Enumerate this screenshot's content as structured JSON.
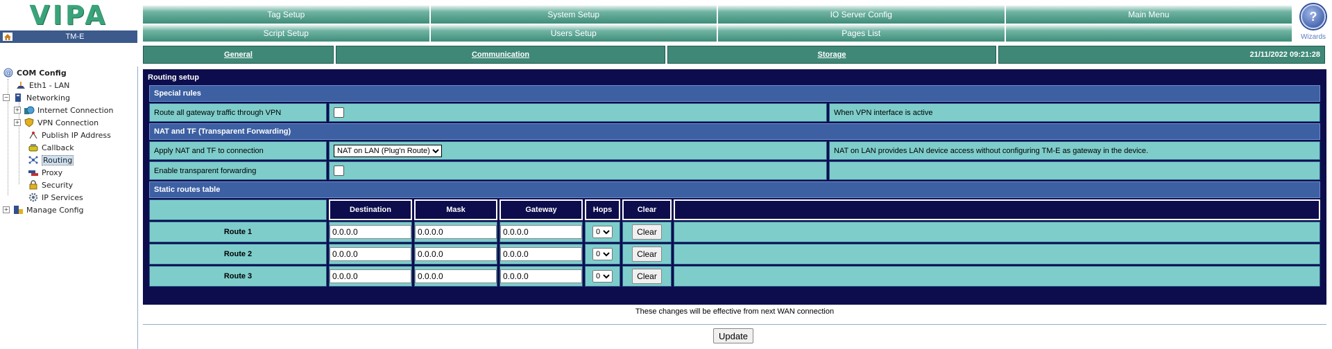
{
  "brand": {
    "logo_text": "VIPA",
    "device_name": "TM-E"
  },
  "top_menu": {
    "row1": [
      "Tag Setup",
      "System Setup",
      "IO Server Config",
      "Main Menu"
    ],
    "row2": [
      "Script Setup",
      "Users Setup",
      "Pages List",
      ""
    ]
  },
  "help": {
    "symbol": "?",
    "label": "Wizards"
  },
  "sub_tabs": [
    "General",
    "Communication",
    "Storage"
  ],
  "datetime": "21/11/2022 09:21:28",
  "tree": {
    "root": "COM Config",
    "eth": "Eth1 - LAN",
    "networking": "Networking",
    "internet": "Internet Connection",
    "vpn": "VPN Connection",
    "publish": "Publish IP Address",
    "callback": "Callback",
    "routing": "Routing",
    "proxy": "Proxy",
    "security": "Security",
    "ipservices": "IP Services",
    "manage": "Manage Config"
  },
  "panel": {
    "title": "Routing setup",
    "special_rules": {
      "heading": "Special rules",
      "label": "Route all gateway traffic through VPN",
      "checked": false,
      "note": "When VPN interface is active"
    },
    "nat": {
      "heading": "NAT and TF (Transparent Forwarding)",
      "apply_label": "Apply NAT and TF to connection",
      "apply_value": "NAT on LAN (Plug'n Route)",
      "apply_note": "NAT on LAN provides LAN device access without configuring TM-E as gateway in the device.",
      "tf_label": "Enable transparent forwarding",
      "tf_checked": false
    },
    "static": {
      "heading": "Static routes table",
      "columns": [
        "Destination",
        "Mask",
        "Gateway",
        "Hops",
        "Clear"
      ],
      "routes": [
        {
          "name": "Route 1",
          "destination": "0.0.0.0",
          "mask": "0.0.0.0",
          "gateway": "0.0.0.0",
          "hops": "0",
          "clear": "Clear"
        },
        {
          "name": "Route 2",
          "destination": "0.0.0.0",
          "mask": "0.0.0.0",
          "gateway": "0.0.0.0",
          "hops": "0",
          "clear": "Clear"
        },
        {
          "name": "Route 3",
          "destination": "0.0.0.0",
          "mask": "0.0.0.0",
          "gateway": "0.0.0.0",
          "hops": "0",
          "clear": "Clear"
        }
      ]
    }
  },
  "footer": {
    "note": "These changes will be effective from next WAN connection",
    "update_label": "Update"
  }
}
